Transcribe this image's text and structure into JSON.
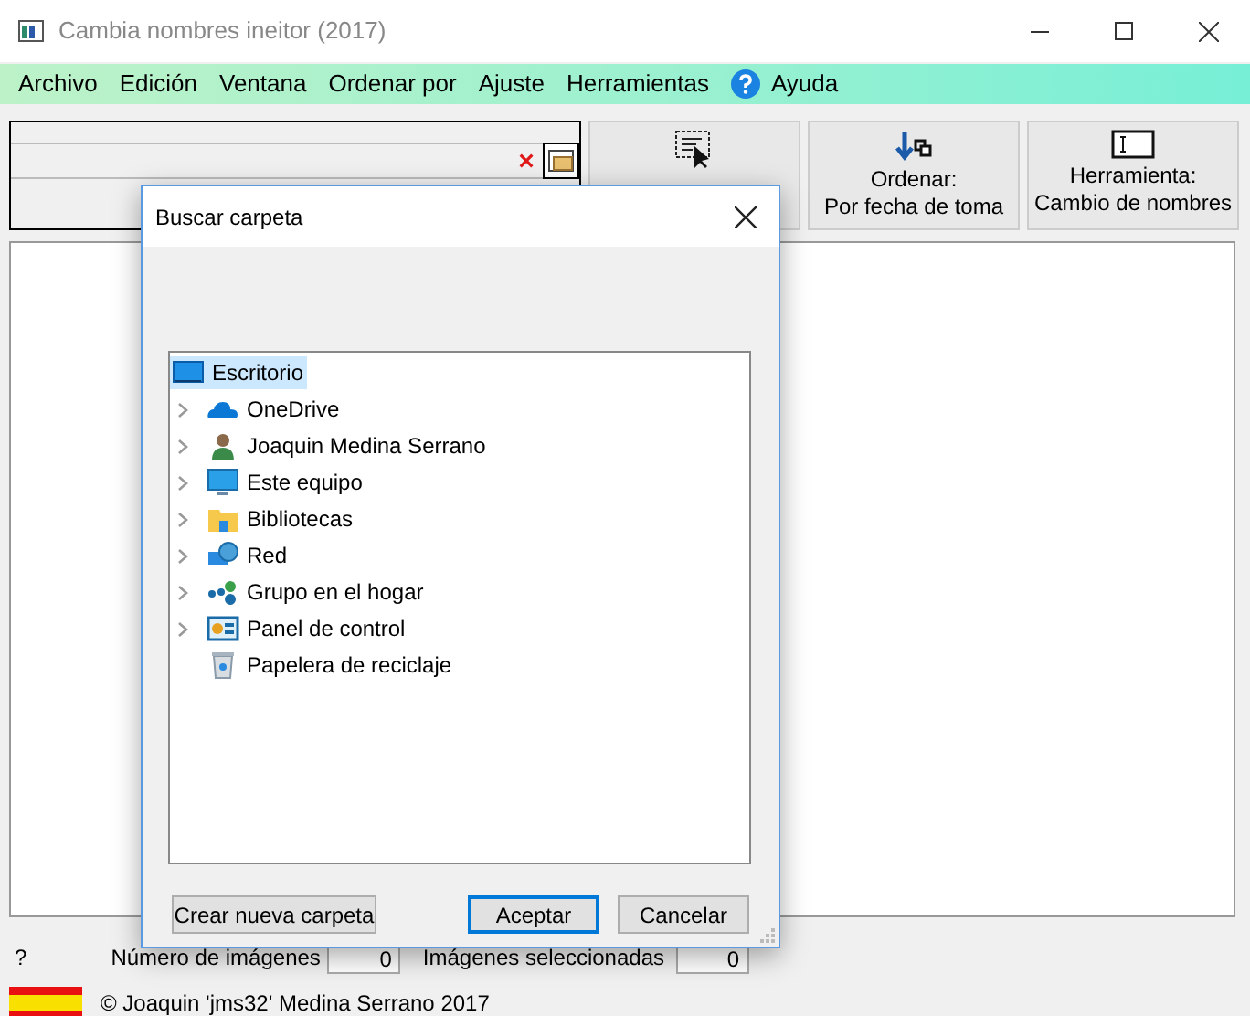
{
  "window": {
    "title": "Cambia nombres ineitor (2017)"
  },
  "menu": [
    {
      "label": "Archivo",
      "kind": "text"
    },
    {
      "label": "Edición",
      "kind": "text"
    },
    {
      "label": "Ventana",
      "kind": "text"
    },
    {
      "label": "Ordenar por",
      "kind": "text"
    },
    {
      "label": "Ajuste",
      "kind": "text"
    },
    {
      "label": "Herramientas",
      "kind": "text"
    },
    {
      "label": "Ayuda",
      "kind": "help"
    }
  ],
  "path_field": {
    "clear": "×"
  },
  "toolbar": [
    {
      "kind": "select"
    },
    {
      "lines": [
        "Ordenar:",
        "Por fecha de toma"
      ],
      "kind": "sort"
    },
    {
      "lines": [
        "Herramienta:",
        "Cambio de nombres"
      ],
      "kind": "tool"
    }
  ],
  "dialog": {
    "title": "Buscar carpeta",
    "tree": [
      {
        "label": "Escritorio",
        "kind": "desktop",
        "expandable": false,
        "selected": true
      },
      {
        "label": "OneDrive",
        "kind": "cloud",
        "expandable": true,
        "selected": false
      },
      {
        "label": "Joaquin Medina Serrano",
        "kind": "user",
        "expandable": true,
        "selected": false
      },
      {
        "label": "Este equipo",
        "kind": "computer",
        "expandable": true,
        "selected": false
      },
      {
        "label": "Bibliotecas",
        "kind": "library",
        "expandable": true,
        "selected": false
      },
      {
        "label": "Red",
        "kind": "network",
        "expandable": true,
        "selected": false
      },
      {
        "label": "Grupo en el hogar",
        "kind": "homegroup",
        "expandable": true,
        "selected": false
      },
      {
        "label": "Panel de control",
        "kind": "control-panel",
        "expandable": true,
        "selected": false
      },
      {
        "label": "Papelera de reciclaje",
        "kind": "recycle-bin",
        "expandable": false,
        "selected": false
      }
    ],
    "buttons": [
      {
        "label": "Crear nueva carpeta",
        "default": false
      },
      {
        "label": "Aceptar",
        "default": true
      },
      {
        "label": "Cancelar",
        "default": false
      }
    ]
  },
  "status": {
    "help": "?",
    "image_count_label": "Número de imágenes",
    "image_count": "0",
    "selected_label": "Imágenes seleccionadas",
    "selected_count": "0"
  },
  "footer": {
    "copyright": "© Joaquin 'jms32' Medina Serrano 2017"
  }
}
